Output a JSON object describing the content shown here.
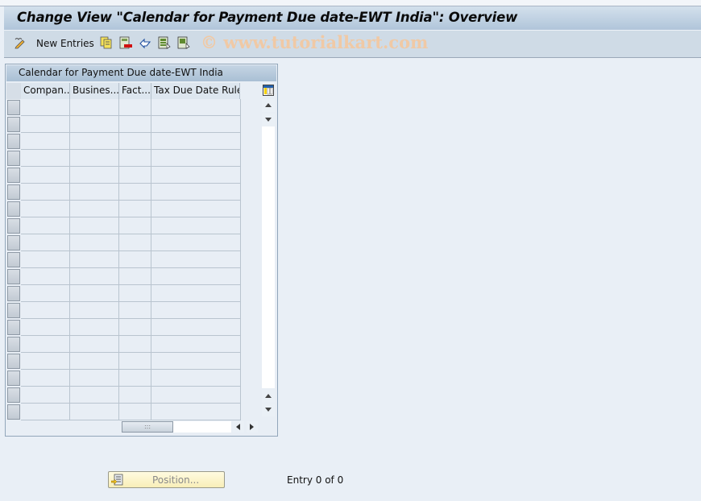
{
  "window": {
    "title": "Change View \"Calendar for Payment Due date-EWT India\": Overview"
  },
  "toolbar": {
    "new_entries_label": "New Entries",
    "icons": [
      "display-change-icon",
      "copy-icon",
      "delete-icon",
      "undo-icon",
      "select-all-icon",
      "select-block-icon"
    ],
    "watermark": "© www.tutorialkart.com"
  },
  "table": {
    "title": "Calendar for Payment Due date-EWT India",
    "columns": [
      "Compan...",
      "Busines...",
      "Fact...",
      "Tax Due Date Rule"
    ],
    "rows": [
      [
        "",
        "",
        "",
        ""
      ],
      [
        "",
        "",
        "",
        ""
      ],
      [
        "",
        "",
        "",
        ""
      ],
      [
        "",
        "",
        "",
        ""
      ],
      [
        "",
        "",
        "",
        ""
      ],
      [
        "",
        "",
        "",
        ""
      ],
      [
        "",
        "",
        "",
        ""
      ],
      [
        "",
        "",
        "",
        ""
      ],
      [
        "",
        "",
        "",
        ""
      ],
      [
        "",
        "",
        "",
        ""
      ],
      [
        "",
        "",
        "",
        ""
      ],
      [
        "",
        "",
        "",
        ""
      ],
      [
        "",
        "",
        "",
        ""
      ],
      [
        "",
        "",
        "",
        ""
      ],
      [
        "",
        "",
        "",
        ""
      ],
      [
        "",
        "",
        "",
        ""
      ],
      [
        "",
        "",
        "",
        ""
      ],
      [
        "",
        "",
        "",
        ""
      ],
      [
        "",
        "",
        "",
        ""
      ]
    ],
    "hscroll_thumb_glyph": ":::"
  },
  "footer": {
    "position_button_label": "Position...",
    "entry_text": "Entry 0 of 0"
  }
}
